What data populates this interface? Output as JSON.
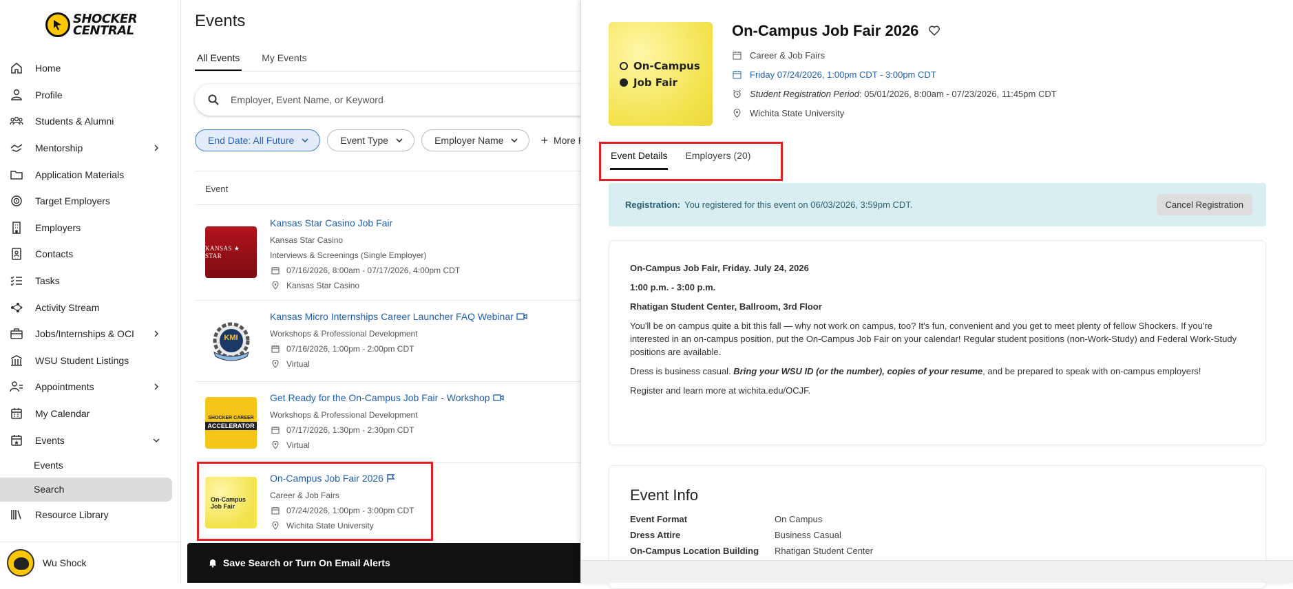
{
  "brand": {
    "line1": "SHOCKER",
    "line2": "CENTRAL"
  },
  "sidebar": {
    "items": [
      {
        "label": "Home"
      },
      {
        "label": "Profile"
      },
      {
        "label": "Students & Alumni"
      },
      {
        "label": "Mentorship"
      },
      {
        "label": "Application Materials"
      },
      {
        "label": "Target Employers"
      },
      {
        "label": "Employers"
      },
      {
        "label": "Contacts"
      },
      {
        "label": "Tasks"
      },
      {
        "label": "Activity Stream"
      },
      {
        "label": "Jobs/Internships & OCI"
      },
      {
        "label": "WSU Student Listings"
      },
      {
        "label": "Appointments"
      },
      {
        "label": "My Calendar"
      },
      {
        "label": "Events"
      }
    ],
    "sub_items": [
      {
        "label": "Events"
      },
      {
        "label": "Search"
      }
    ],
    "resource": "Resource Library",
    "user": "Wu Shock"
  },
  "main": {
    "title": "Events",
    "tabs": [
      {
        "label": "All Events"
      },
      {
        "label": "My Events"
      }
    ],
    "search_placeholder": "Employer, Event Name, or Keyword",
    "filters": [
      "End Date: All Future",
      "Event Type",
      "Employer Name"
    ],
    "more_filters": "More Filte",
    "list_header": "Event",
    "events": [
      {
        "name": "Kansas Star Casino Job Fair",
        "line1": "Kansas Star Casino",
        "line2": "Interviews & Screenings (Single Employer)",
        "date": "07/16/2026, 8:00am - 07/17/2026, 4:00pm CDT",
        "location": "Kansas Star Casino"
      },
      {
        "name": "Kansas Micro Internships Career Launcher FAQ Webinar",
        "line1": "Workshops & Professional Development",
        "date": "07/16/2026, 1:00pm - 2:00pm CDT",
        "location": "Virtual"
      },
      {
        "name": "Get Ready for the On-Campus Job Fair - Workshop",
        "line1": "Workshops & Professional Development",
        "date": "07/17/2026, 1:30pm - 2:30pm CDT",
        "location": "Virtual"
      },
      {
        "name": "On-Campus Job Fair 2026",
        "line1": "Career & Job Fairs",
        "date": "07/24/2026, 1:00pm - 3:00pm CDT",
        "location": "Wichita State University"
      }
    ],
    "thumbs": {
      "kansas_star": "KANSAS ★ STAR",
      "kmi": "KMI",
      "accelerator_1": "SHOCKER CAREER",
      "accelerator_2": "ACCELERATOR",
      "ojf_1": "On-Campus",
      "ojf_2": "Job Fair"
    },
    "save_bar": "Save Search or Turn On Email Alerts"
  },
  "detail": {
    "title": "On-Campus Job Fair 2026",
    "category": "Career & Job Fairs",
    "datetime": "Friday 07/24/2026, 1:00pm CDT - 3:00pm CDT",
    "reg_period_label": "Student Registration Period",
    "reg_period": "05/01/2026, 8:00am - 07/23/2026, 11:45pm CDT",
    "location": "Wichita State University",
    "thumb_line1": "On-Campus",
    "thumb_line2": "Job Fair",
    "tabs": [
      {
        "label": "Event Details"
      },
      {
        "label": "Employers (20)"
      }
    ],
    "registration_label": "Registration:",
    "registration_text": "You registered for this event on 06/03/2026, 3:59pm CDT.",
    "cancel_label": "Cancel Registration",
    "desc_h1": "On-Campus Job Fair, Friday. July 24, 2026",
    "desc_h2": "1:00 p.m. - 3:00 p.m.",
    "desc_h3": "Rhatigan Student  Center, Ballroom, 3rd Floor",
    "desc_p1": "You'll be on campus quite a bit this fall — why not work on campus, too? It's fun, convenient and you get to meet plenty of fellow Shockers. If you're interested in an on-campus position, put the On-Campus Job Fair on your calendar! Regular student positions (non-Work-Study) and Federal Work-Study positions are available.",
    "desc_p2_a": "Dress is business casual. ",
    "desc_p2_b": "Bring your WSU ID (or the number), copies of your resume",
    "desc_p2_c": ", and be prepared to speak with on-campus employers!",
    "desc_p3": "Register and learn more at wichita.edu/OCJF.",
    "info_title": "Event Info",
    "info": [
      {
        "k": "Event Format",
        "v": "On Campus"
      },
      {
        "k": "Dress Attire",
        "v": "Business Casual"
      },
      {
        "k": "On-Campus Location Building",
        "v": "Rhatigan Student Center"
      }
    ]
  },
  "colors": {
    "link": "#1f5fae",
    "highlight": "#e01f26",
    "brand_yellow": "#ffc700"
  }
}
